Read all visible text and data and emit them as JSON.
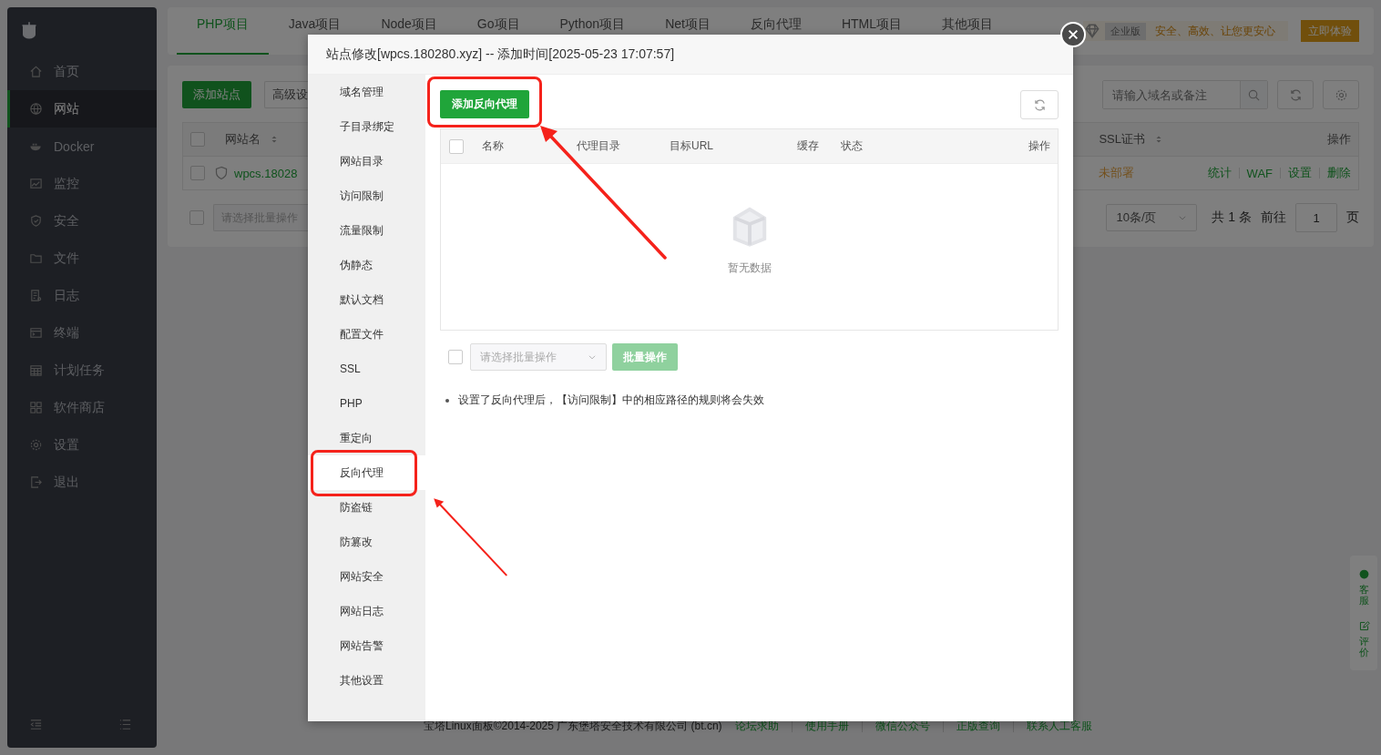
{
  "sidebar": {
    "items": [
      {
        "label": "首页",
        "selected": false
      },
      {
        "label": "网站",
        "selected": true
      },
      {
        "label": "Docker",
        "selected": false
      },
      {
        "label": "监控",
        "selected": false
      },
      {
        "label": "安全",
        "selected": false
      },
      {
        "label": "文件",
        "selected": false
      },
      {
        "label": "日志",
        "selected": false
      },
      {
        "label": "终端",
        "selected": false
      },
      {
        "label": "计划任务",
        "selected": false
      },
      {
        "label": "软件商店",
        "selected": false
      },
      {
        "label": "设置",
        "selected": false
      },
      {
        "label": "退出",
        "selected": false
      }
    ]
  },
  "project_tabs": [
    {
      "label": "PHP项目",
      "selected": true
    },
    {
      "label": "Java项目",
      "selected": false
    },
    {
      "label": "Node项目",
      "selected": false
    },
    {
      "label": "Go项目",
      "selected": false
    },
    {
      "label": "Python项目",
      "selected": false
    },
    {
      "label": "Net项目",
      "selected": false
    },
    {
      "label": "反向代理",
      "selected": false
    },
    {
      "label": "HTML项目",
      "selected": false
    },
    {
      "label": "其他项目",
      "selected": false
    }
  ],
  "promo": {
    "badge": "企业版",
    "slogan": "安全、高效、让您更安心",
    "button": "立即体验"
  },
  "site_list": {
    "buttons": [
      "添加站点",
      "高级设"
    ],
    "search": {
      "placeholder": "请输入域名或备注"
    },
    "header_checked": false,
    "columns": {
      "left": "网站名",
      "ssl": "SSL证书",
      "actions": "操作"
    },
    "row": {
      "checked": false,
      "name": "wpcs.18028",
      "ssl": "未部署",
      "links": [
        "统计",
        "WAF",
        "设置",
        "删除"
      ]
    },
    "batch_checked": false,
    "batch_placeholder": "请选择批量操作",
    "page_size": "10条/页",
    "total": "共 1 条",
    "goto": "前往",
    "page": "1",
    "page_suffix": "页"
  },
  "modal": {
    "title": "站点修改[wpcs.180280.xyz] -- 添加时间[2025-05-23 17:07:57]",
    "nav": [
      {
        "label": "域名管理",
        "selected": false,
        "highlighted": false
      },
      {
        "label": "子目录绑定",
        "selected": false,
        "highlighted": false
      },
      {
        "label": "网站目录",
        "selected": false,
        "highlighted": false
      },
      {
        "label": "访问限制",
        "selected": false,
        "highlighted": false
      },
      {
        "label": "流量限制",
        "selected": false,
        "highlighted": false
      },
      {
        "label": "伪静态",
        "selected": false,
        "highlighted": false
      },
      {
        "label": "默认文档",
        "selected": false,
        "highlighted": false
      },
      {
        "label": "配置文件",
        "selected": false,
        "highlighted": false
      },
      {
        "label": "SSL",
        "selected": false,
        "highlighted": false
      },
      {
        "label": "PHP",
        "selected": false,
        "highlighted": false
      },
      {
        "label": "重定向",
        "selected": false,
        "highlighted": false
      },
      {
        "label": "反向代理",
        "selected": true,
        "highlighted": true
      },
      {
        "label": "防盗链",
        "selected": false,
        "highlighted": false
      },
      {
        "label": "防篡改",
        "selected": false,
        "highlighted": false
      },
      {
        "label": "网站安全",
        "selected": false,
        "highlighted": false
      },
      {
        "label": "网站日志",
        "selected": false,
        "highlighted": false
      },
      {
        "label": "网站告警",
        "selected": false,
        "highlighted": false
      },
      {
        "label": "其他设置",
        "selected": false,
        "highlighted": false
      }
    ],
    "add_button": {
      "label": "添加反向代理",
      "highlighted": true
    },
    "header_checked": false,
    "columns": [
      "名称",
      "代理目录",
      "目标URL",
      "缓存",
      "状态",
      "操作"
    ],
    "empty_text": "暂无数据",
    "batch": {
      "checked": false,
      "placeholder": "请选择批量操作",
      "button": "批量操作",
      "disabled": true
    },
    "note": "设置了反向代理后，【访问限制】中的相应路径的规则将会失效"
  },
  "footer": {
    "copyright": "宝塔Linux面板©2014-2025 广东堡塔安全技术有限公司 (bt.cn)",
    "links": [
      "论坛求助",
      "使用手册",
      "微信公众号",
      "正版查询",
      "联系人工客服"
    ]
  },
  "float_panel": [
    "客服",
    "评价"
  ]
}
